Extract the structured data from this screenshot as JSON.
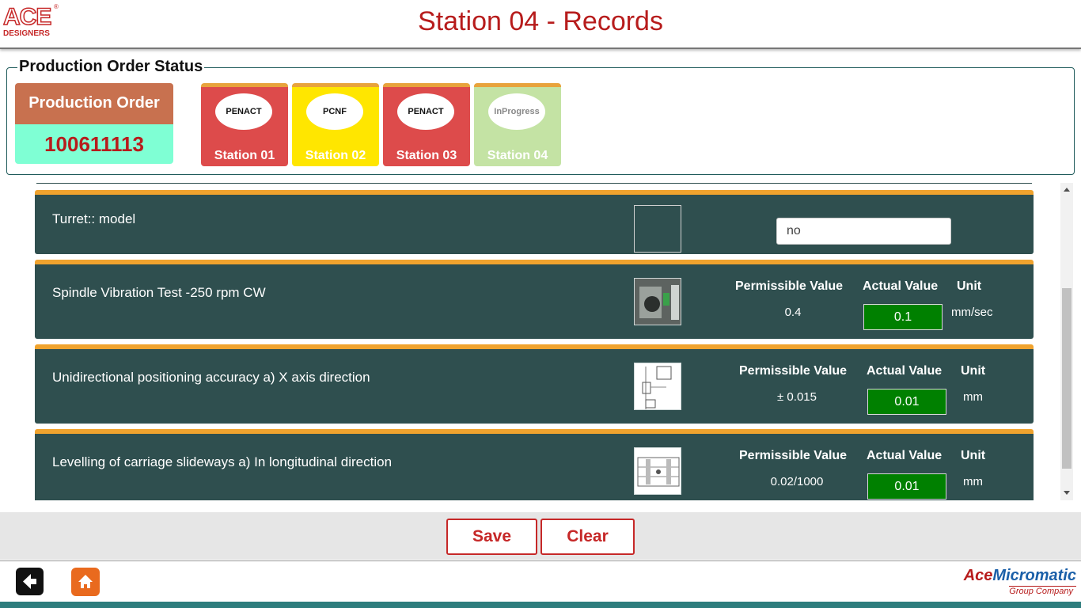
{
  "header": {
    "logo_letters": "ACE",
    "logo_sub": "DESIGNERS",
    "logo_reg": "®",
    "title": "Station 04 - Records"
  },
  "status": {
    "legend": "Production Order Status",
    "production_order_label": "Production Order",
    "production_order_number": "100611113",
    "stations": [
      {
        "name": "Station 01",
        "status": "PENACT",
        "color": "#dd4b4b"
      },
      {
        "name": "Station 02",
        "status": "PCNF",
        "color": "#ffe600"
      },
      {
        "name": "Station 03",
        "status": "PENACT",
        "color": "#dd4b4b"
      },
      {
        "name": "Station 04",
        "status": "InProgress",
        "color": "#c4e3a4"
      }
    ]
  },
  "records": [
    {
      "label": "Turret:: model",
      "input_value": "no"
    },
    {
      "label": "Spindle Vibration Test -250 rpm CW",
      "permissible_header": "Permissible Value",
      "actual_header": "Actual Value",
      "unit_header": "Unit",
      "permissible_value": "0.4",
      "actual_value": "0.1",
      "unit": "mm/sec",
      "image_icon": "spindle-photo-icon"
    },
    {
      "label": "Unidirectional positioning accuracy a) X axis direction",
      "permissible_header": "Permissible Value",
      "actual_header": "Actual Value",
      "unit_header": "Unit",
      "permissible_value": "± 0.015",
      "actual_value": "0.01",
      "unit": "mm",
      "image_icon": "axis-diagram-icon"
    },
    {
      "label": "Levelling of carriage slideways a)  In longitudinal direction",
      "permissible_header": "Permissible Value",
      "actual_header": "Actual Value",
      "unit_header": "Unit",
      "permissible_value": "0.02/1000",
      "actual_value": "0.01",
      "unit": "mm",
      "image_icon": "slideway-diagram-icon"
    }
  ],
  "actions": {
    "save_label": "Save",
    "clear_label": "Clear"
  },
  "footer": {
    "brand_ace": "Ace",
    "brand_micromatic": "Micromatic",
    "brand_sub": "Group Company"
  },
  "colors": {
    "accent_red": "#b71c1c",
    "record_bg": "#2f4f4f",
    "record_border": "#f0a32e",
    "actual_bg": "#008000"
  }
}
